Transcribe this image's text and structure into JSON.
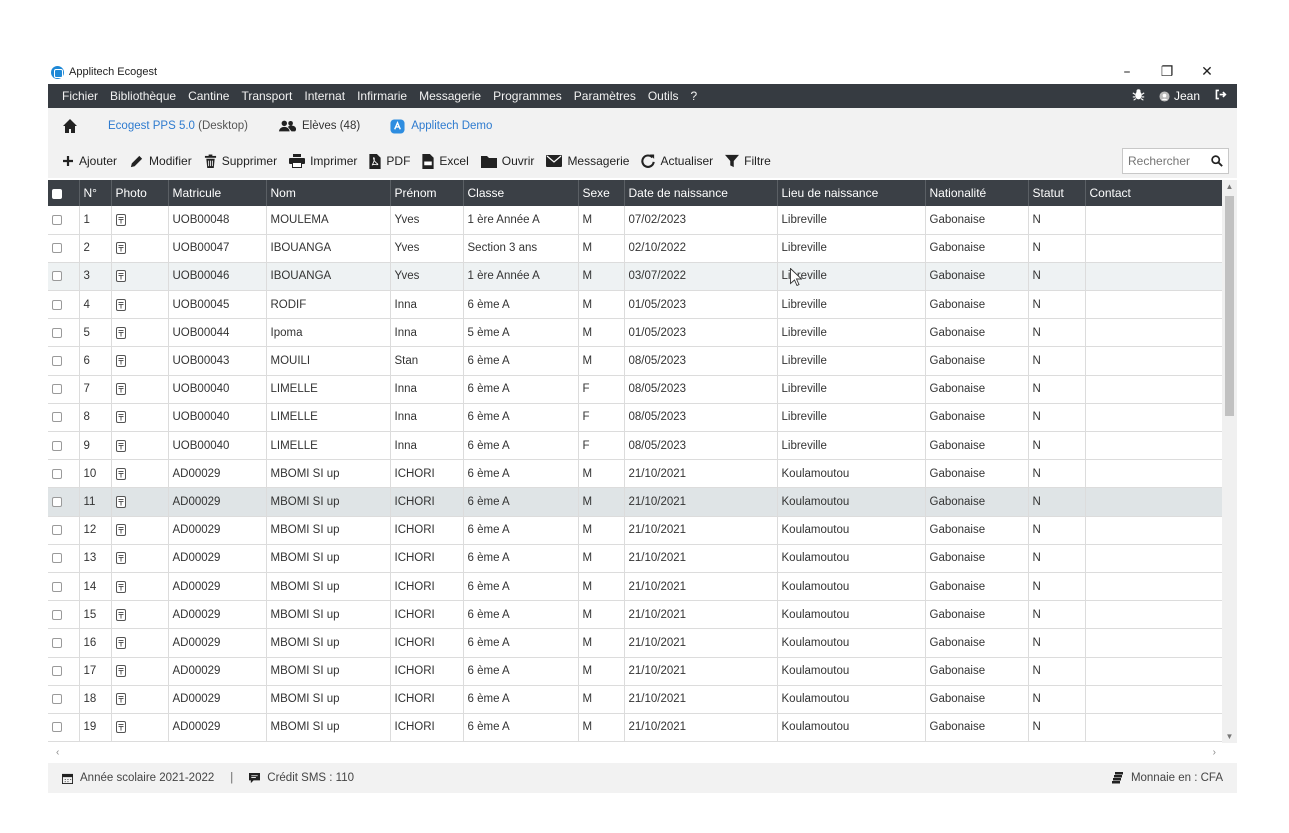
{
  "window": {
    "title": "Applitech Ecogest",
    "controls": [
      "–",
      "❐",
      "✕"
    ]
  },
  "menubar": {
    "items": [
      "Fichier",
      "Bibliothèque",
      "Cantine",
      "Transport",
      "Internat",
      "Infirmarie",
      "Messagerie",
      "Programmes",
      "Paramètres",
      "Outils",
      "?"
    ],
    "user": "Jean"
  },
  "tabs": {
    "app": "Ecogest PPS 5.0",
    "app_sub": "(Desktop)",
    "students": "Elèves (48)",
    "school": "Applitech Demo"
  },
  "toolbar": {
    "add": "Ajouter",
    "edit": "Modifier",
    "delete": "Supprimer",
    "print": "Imprimer",
    "pdf": "PDF",
    "excel": "Excel",
    "open": "Ouvrir",
    "messaging": "Messagerie",
    "refresh": "Actualiser",
    "filter": "Filtre",
    "search_placeholder": "Rechercher"
  },
  "table": {
    "headers": [
      "N°",
      "Photo",
      "Matricule",
      "Nom",
      "Prénom",
      "Classe",
      "Sexe",
      "Date de naissance",
      "Lieu de naissance",
      "Nationalité",
      "Statut",
      "Contact"
    ],
    "rows": [
      [
        "1",
        "UOB00048",
        "MOULEMA",
        "Yves",
        "1 ère Année A",
        "M",
        "07/02/2023",
        "Libreville",
        "Gabonaise",
        "N",
        ""
      ],
      [
        "2",
        "UOB00047",
        "IBOUANGA",
        "Yves",
        "Section 3 ans",
        "M",
        "02/10/2022",
        "Libreville",
        "Gabonaise",
        "N",
        ""
      ],
      [
        "3",
        "UOB00046",
        "IBOUANGA",
        "Yves",
        "1 ère Année A",
        "M",
        "03/07/2022",
        "Libreville",
        "Gabonaise",
        "N",
        ""
      ],
      [
        "4",
        "UOB00045",
        "RODIF",
        "Inna",
        "6 ème A",
        "M",
        "01/05/2023",
        "Libreville",
        "Gabonaise",
        "N",
        ""
      ],
      [
        "5",
        "UOB00044",
        "Ipoma",
        "Inna",
        "5 ème A",
        "M",
        "01/05/2023",
        "Libreville",
        "Gabonaise",
        "N",
        ""
      ],
      [
        "6",
        "UOB00043",
        "MOUILI",
        "Stan",
        "6 ème A",
        "M",
        "08/05/2023",
        "Libreville",
        "Gabonaise",
        "N",
        ""
      ],
      [
        "7",
        "UOB00040",
        "LIMELLE",
        "Inna",
        "6 ème A",
        "F",
        "08/05/2023",
        "Libreville",
        "Gabonaise",
        "N",
        ""
      ],
      [
        "8",
        "UOB00040",
        "LIMELLE",
        "Inna",
        "6 ème A",
        "F",
        "08/05/2023",
        "Libreville",
        "Gabonaise",
        "N",
        ""
      ],
      [
        "9",
        "UOB00040",
        "LIMELLE",
        "Inna",
        "6 ème A",
        "F",
        "08/05/2023",
        "Libreville",
        "Gabonaise",
        "N",
        ""
      ],
      [
        "10",
        "AD00029",
        "MBOMI SI up",
        "ICHORI",
        "6 ème A",
        "M",
        "21/10/2021",
        "Koulamoutou",
        "Gabonaise",
        "N",
        ""
      ],
      [
        "11",
        "AD00029",
        "MBOMI SI up",
        "ICHORI",
        "6 ème A",
        "M",
        "21/10/2021",
        "Koulamoutou",
        "Gabonaise",
        "N",
        ""
      ],
      [
        "12",
        "AD00029",
        "MBOMI SI up",
        "ICHORI",
        "6 ème A",
        "M",
        "21/10/2021",
        "Koulamoutou",
        "Gabonaise",
        "N",
        ""
      ],
      [
        "13",
        "AD00029",
        "MBOMI SI up",
        "ICHORI",
        "6 ème A",
        "M",
        "21/10/2021",
        "Koulamoutou",
        "Gabonaise",
        "N",
        ""
      ],
      [
        "14",
        "AD00029",
        "MBOMI SI up",
        "ICHORI",
        "6 ème A",
        "M",
        "21/10/2021",
        "Koulamoutou",
        "Gabonaise",
        "N",
        ""
      ],
      [
        "15",
        "AD00029",
        "MBOMI SI up",
        "ICHORI",
        "6 ème A",
        "M",
        "21/10/2021",
        "Koulamoutou",
        "Gabonaise",
        "N",
        ""
      ],
      [
        "16",
        "AD00029",
        "MBOMI SI up",
        "ICHORI",
        "6 ème A",
        "M",
        "21/10/2021",
        "Koulamoutou",
        "Gabonaise",
        "N",
        ""
      ],
      [
        "17",
        "AD00029",
        "MBOMI SI up",
        "ICHORI",
        "6 ème A",
        "M",
        "21/10/2021",
        "Koulamoutou",
        "Gabonaise",
        "N",
        ""
      ],
      [
        "18",
        "AD00029",
        "MBOMI SI up",
        "ICHORI",
        "6 ème A",
        "M",
        "21/10/2021",
        "Koulamoutou",
        "Gabonaise",
        "N",
        ""
      ],
      [
        "19",
        "AD00029",
        "MBOMI SI up",
        "ICHORI",
        "6 ème A",
        "M",
        "21/10/2021",
        "Koulamoutou",
        "Gabonaise",
        "N",
        ""
      ]
    ],
    "selected_row": "11",
    "hover_row": "3"
  },
  "status": {
    "school_year": "Année scolaire 2021-2022",
    "separator": "|",
    "sms_credit": "Crédit SMS : 110",
    "currency": "Monnaie en : CFA"
  },
  "colors": {
    "menubar_bg": "#363b41",
    "header_bg": "#3b4046",
    "accent_blue": "#2e7bcf",
    "selected_row": "#dfe4e6"
  }
}
